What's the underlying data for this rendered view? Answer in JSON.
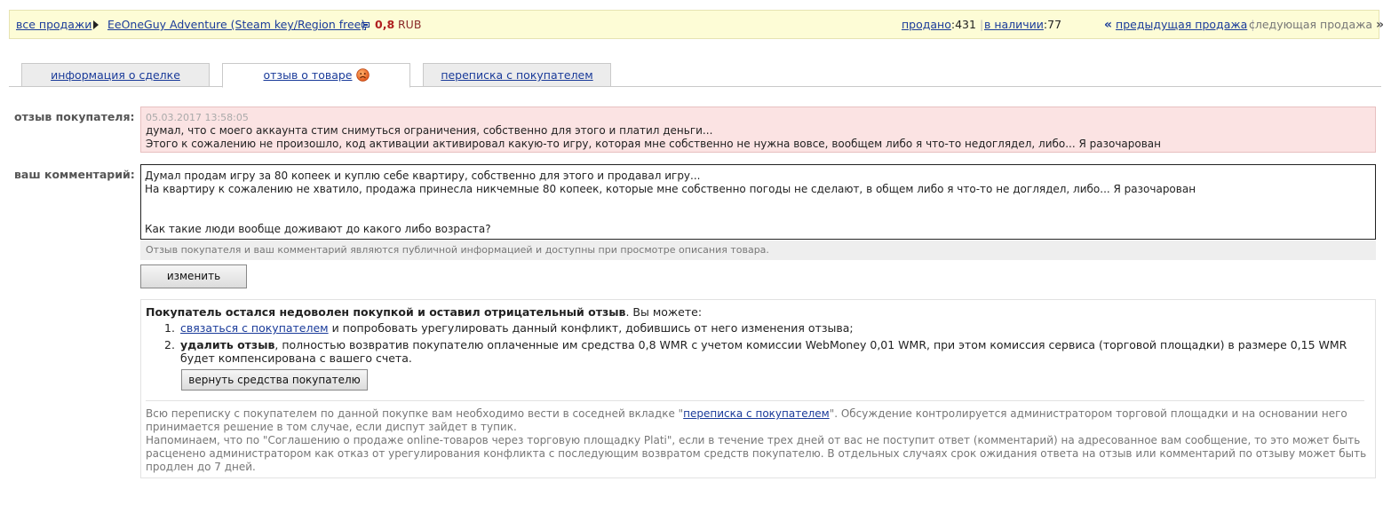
{
  "topbar": {
    "all_sales": "все продажи",
    "product_title": "EeOneGuy Adventure (Steam key/Region free)",
    "price": "0,8",
    "currency": "RUB",
    "sold_label": "продано",
    "sold_count": ":431",
    "stock_label": "в наличии",
    "stock_count": ":77",
    "separator": "|",
    "prev_arrow": "«",
    "prev_label": "предыдущая продажа",
    "next_label": "следующая продажа",
    "next_arrow": "»"
  },
  "tabs": [
    {
      "label": "информация о сделке",
      "active": false
    },
    {
      "label": "отзыв о товаре",
      "active": true,
      "icon": "sad-face-icon"
    },
    {
      "label": "переписка с покупателем",
      "active": false
    }
  ],
  "buyer_review": {
    "label": "отзыв покупателя:",
    "date": "05.03.2017 13:58:05",
    "line1": "думал, что с моего аккаунта стим снимуться ограничения, собственно для этого и платил деньги...",
    "line2": "Этого к сожалению не произошло, код активации активировал какую-то игру, которая мне собственно не нужна вовсе, вообщем либо я что-то недоглядел, либо... Я разочарован"
  },
  "your_comment": {
    "label": "ваш комментарий:",
    "text": "Думал продам игру за 80 копеек и куплю себе квартиру, собственно для этого и продавал игру...\nНа квартиру к сожалению не хватило, продажа принесла никчемные 80 копеек, которые мне собственно погоды не сделают, в общем либо я что-то не доглядел, либо... Я разочарован\n\n\nКак такие люди вообще доживают до какого либо возраста?",
    "public_note": "Отзыв покупателя и ваш комментарий являются публичной информацией и доступны при просмотре описания товара."
  },
  "edit_button": "изменить",
  "info_panel": {
    "headline_bold": "Покупатель остался недоволен покупкой и оставил отрицательный отзыв",
    "headline_rest": ". Вы можете:",
    "option1_num": "1.",
    "option1_link": "связаться с покупателем",
    "option1_rest": " и попробовать урегулировать данный конфликт, добившись от него изменения отзыва;",
    "option2_num": "2.",
    "option2_bold": "удалить отзыв",
    "option2_rest": ", полностью возвратив покупателю оплаченные им средства 0,8 WMR с учетом комиссии WebMoney 0,01 WMR, при этом комиссия сервиса (торговой площадки) в размере 0,15 WMR будет компенсирована с вашего счета.",
    "refund_button": "вернуть средства покупателю",
    "footer_p1_start": "Всю переписку с покупателем по данной покупке вам необходимо вести в соседней вкладке \"",
    "footer_p1_link": "переписка с покупателем",
    "footer_p1_end": "\". Обсуждение контролируется администратором торговой площадки и на основании него принимается решение в том случае, если диспут зайдет в тупик.",
    "footer_p2": "Напоминаем, что по \"Соглашению о продаже online-товаров через торговую площадку Plati\", если в течение трех дней от вас не поступит ответ (комментарий) на адресованное вам сообщение, то это может быть расценено администратором как отказ от урегулирования конфликта с последующим возвратом средств покупателю. В отдельных случаях срок ожидания ответа на отзыв или комментарий по отзыву может быть продлен до 7 дней."
  },
  "colors": {
    "topbar_bg": "#fdfcd6",
    "review_bg": "#fbe3e3",
    "link": "#1a3b9a",
    "price": "#b02020"
  }
}
